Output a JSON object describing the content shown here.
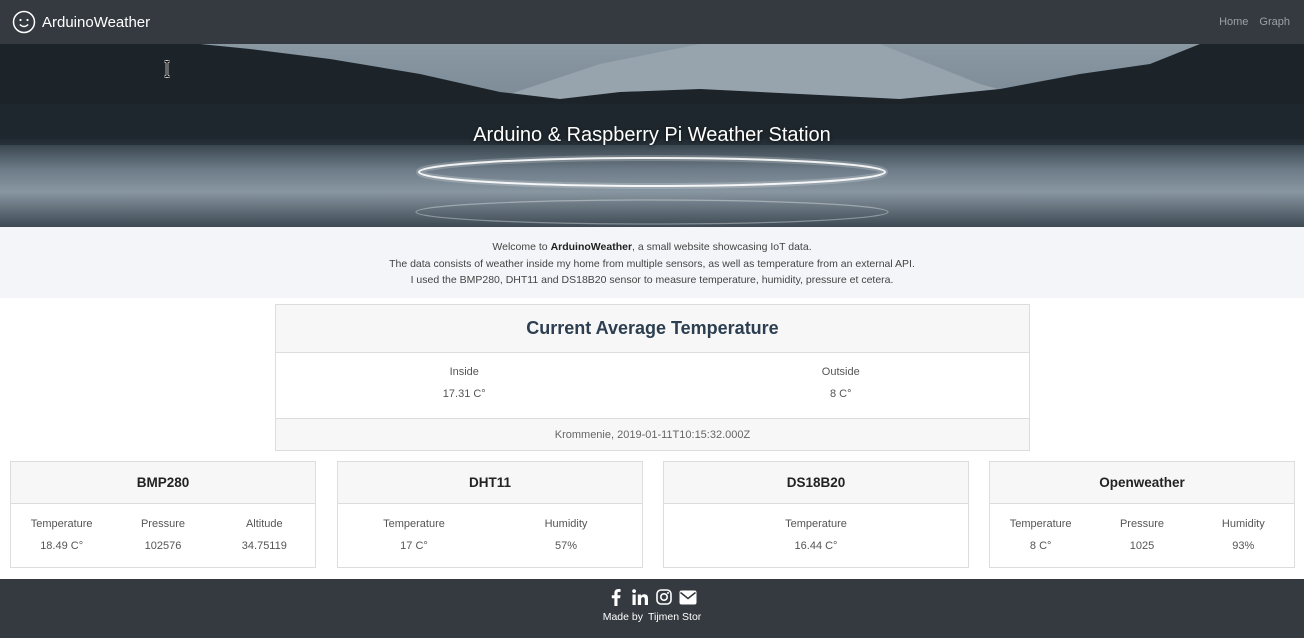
{
  "navbar": {
    "brand": "ArduinoWeather",
    "brand_icon": "smiley-icon",
    "links": [
      "Home",
      "Graph"
    ]
  },
  "hero": {
    "title": "Arduino & Raspberry Pi Weather Station"
  },
  "intro": {
    "line1_pre": "Welcome to ",
    "line1_bold": "ArduinoWeather",
    "line1_post": ", a small website showcasing IoT data.",
    "line2": "The data consists of weather inside my home from multiple sensors, as well as temperature from an external API.",
    "line3": "I used the BMP280, DHT11 and DS18B20 sensor to measure temperature, humidity, pressure et cetera."
  },
  "average": {
    "title": "Current Average Temperature",
    "inside_label": "Inside",
    "inside_value": "17.31 C°",
    "outside_label": "Outside",
    "outside_value": "8 C°",
    "footer": "Krommenie, 2019-01-11T10:15:32.000Z"
  },
  "sensors": [
    {
      "name": "BMP280",
      "fields": [
        {
          "label": "Temperature",
          "value": "18.49 C°"
        },
        {
          "label": "Pressure",
          "value": "102576"
        },
        {
          "label": "Altitude",
          "value": "34.75119"
        }
      ]
    },
    {
      "name": "DHT11",
      "fields": [
        {
          "label": "Temperature",
          "value": "17 C°"
        },
        {
          "label": "Humidity",
          "value": "57%"
        }
      ]
    },
    {
      "name": "DS18B20",
      "fields": [
        {
          "label": "Temperature",
          "value": "16.44 C°"
        }
      ]
    },
    {
      "name": "Openweather",
      "fields": [
        {
          "label": "Temperature",
          "value": "8 C°"
        },
        {
          "label": "Pressure",
          "value": "1025"
        },
        {
          "label": "Humidity",
          "value": "93%"
        }
      ]
    }
  ],
  "footer": {
    "social_icons": [
      "facebook-icon",
      "linkedin-icon",
      "instagram-icon",
      "email-icon"
    ],
    "made_by": "Made by",
    "author": "Tijmen Stor"
  },
  "colors": {
    "navbar": "#343a40",
    "intro_bg": "#f4f5f8",
    "card_header": "#f7f7f7"
  }
}
